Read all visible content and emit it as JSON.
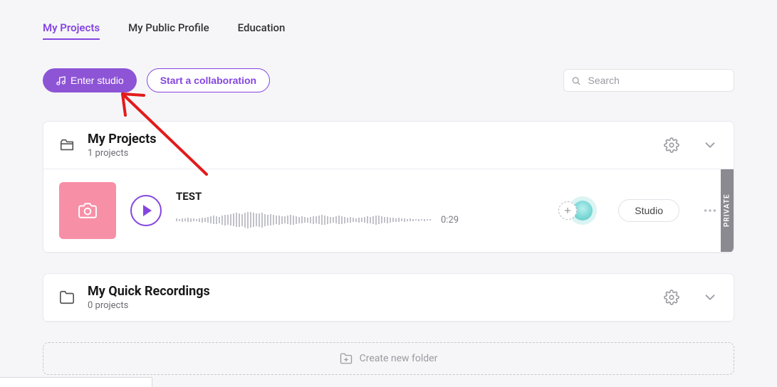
{
  "tabs": {
    "myProjects": "My Projects",
    "publicProfile": "My Public Profile",
    "education": "Education"
  },
  "buttons": {
    "enterStudio": "Enter studio",
    "startCollaboration": "Start a collaboration",
    "projectStudio": "Studio"
  },
  "search": {
    "placeholder": "Search"
  },
  "folders": {
    "myProjects": {
      "title": "My Projects",
      "subtitle": "1 projects"
    },
    "quickRecordings": {
      "title": "My Quick Recordings",
      "subtitle": "0 projects"
    }
  },
  "project": {
    "title": "TEST",
    "duration": "0:29",
    "privacy": "PRIVATE"
  },
  "createFolder": {
    "label": "Create new folder"
  }
}
